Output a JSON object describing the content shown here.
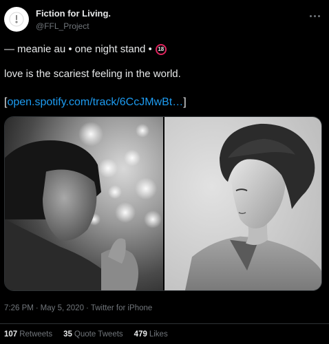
{
  "tweet": {
    "author": {
      "display_name": "Fiction for Living.",
      "handle": "@FFL_Project",
      "avatar_icon": "avatar-logo-icon"
    },
    "menu_icon": "more-horizontal-icon",
    "lines": {
      "line1_text": "— meanie au • one night stand •",
      "line1_badge": "18",
      "line2_text": "love is the scariest feeling in the world.",
      "line3_open": "[",
      "line3_link": "open.spotify.com/track/6CcJMwBt…",
      "line3_close": "]"
    },
    "media": {
      "images": [
        {
          "description_name": "photo-left"
        },
        {
          "description_name": "photo-right"
        }
      ]
    },
    "meta": {
      "time": "7:26 PM",
      "sep1": "·",
      "date": "May 5, 2020",
      "sep2": "·",
      "source": "Twitter for iPhone"
    },
    "stats": {
      "retweets_count": "107",
      "retweets_label": "Retweets",
      "quotes_count": "35",
      "quotes_label": "Quote Tweets",
      "likes_count": "479",
      "likes_label": "Likes"
    }
  },
  "colors": {
    "background": "#000000",
    "text": "#e7e9ea",
    "muted": "#71767b",
    "link": "#1d9bf0",
    "badge_border": "#e0245e",
    "divider": "#2f3336"
  }
}
